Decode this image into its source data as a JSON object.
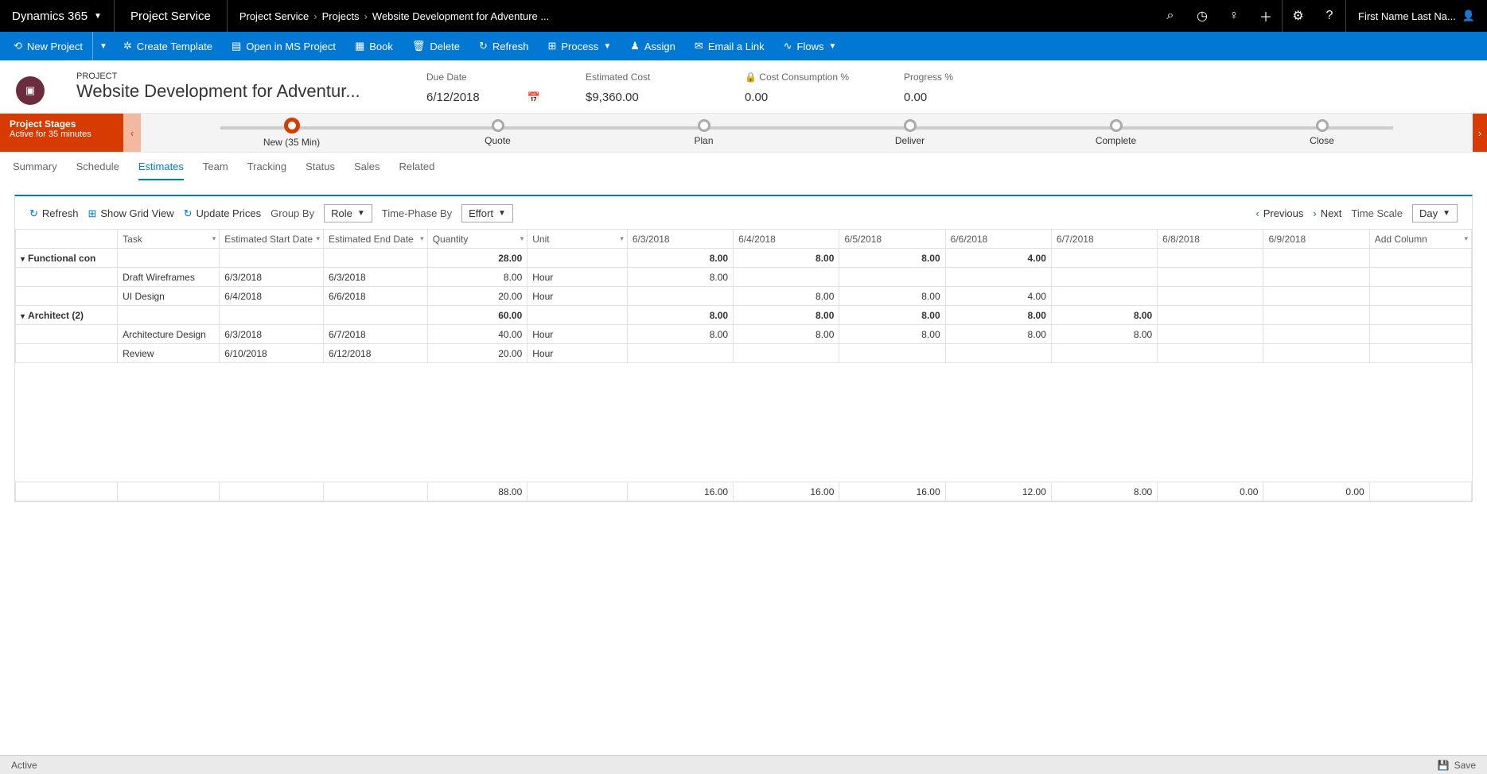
{
  "topbar": {
    "brand": "Dynamics 365",
    "app": "Project Service",
    "breadcrumb": [
      "Project Service",
      "Projects",
      "Website Development for Adventure ..."
    ],
    "user": "First Name Last Na..."
  },
  "cmdbar": {
    "new": "New Project",
    "create_template": "Create Template",
    "open_ms": "Open in MS Project",
    "book": "Book",
    "delete": "Delete",
    "refresh": "Refresh",
    "process": "Process",
    "assign": "Assign",
    "email": "Email a Link",
    "flows": "Flows"
  },
  "header": {
    "label": "PROJECT",
    "title": "Website Development for Adventur...",
    "due_date_label": "Due Date",
    "due_date": "6/12/2018",
    "est_cost_label": "Estimated Cost",
    "est_cost": "$9,360.00",
    "cost_con_label": "Cost Consumption %",
    "cost_con": "0.00",
    "progress_label": "Progress %",
    "progress": "0.00"
  },
  "stagebar": {
    "title": "Project Stages",
    "subtitle": "Active for 35 minutes",
    "stages": [
      "New  (35 Min)",
      "Quote",
      "Plan",
      "Deliver",
      "Complete",
      "Close"
    ]
  },
  "tabs": [
    "Summary",
    "Schedule",
    "Estimates",
    "Team",
    "Tracking",
    "Status",
    "Sales",
    "Related"
  ],
  "active_tab": "Estimates",
  "grid_toolbar": {
    "refresh": "Refresh",
    "grid_view": "Show Grid View",
    "update_prices": "Update Prices",
    "group_by": "Group By",
    "group_by_value": "Role",
    "time_phase": "Time-Phase By",
    "time_phase_value": "Effort",
    "previous": "Previous",
    "next": "Next",
    "time_scale": "Time Scale",
    "time_scale_value": "Day"
  },
  "columns": {
    "task": "Task",
    "start": "Estimated Start Date",
    "end": "Estimated End Date",
    "qty": "Quantity",
    "unit": "Unit",
    "dates": [
      "6/3/2018",
      "6/4/2018",
      "6/5/2018",
      "6/6/2018",
      "6/7/2018",
      "6/8/2018",
      "6/9/2018"
    ],
    "add": "Add Column"
  },
  "group1": {
    "name": "Functional con",
    "qty": "28.00",
    "d": [
      "8.00",
      "8.00",
      "8.00",
      "4.00",
      "",
      "",
      ""
    ]
  },
  "row1": {
    "task": "Draft Wireframes",
    "start": "6/3/2018",
    "end": "6/3/2018",
    "qty": "8.00",
    "unit": "Hour",
    "d": [
      "8.00",
      "",
      "",
      "",
      "",
      "",
      ""
    ]
  },
  "row2": {
    "task": "UI Design",
    "start": "6/4/2018",
    "end": "6/6/2018",
    "qty": "20.00",
    "unit": "Hour",
    "d": [
      "",
      "8.00",
      "8.00",
      "4.00",
      "",
      "",
      ""
    ]
  },
  "group2": {
    "name": "Architect (2)",
    "qty": "60.00",
    "d": [
      "8.00",
      "8.00",
      "8.00",
      "8.00",
      "8.00",
      "",
      ""
    ]
  },
  "row3": {
    "task": "Architecture Design",
    "start": "6/3/2018",
    "end": "6/7/2018",
    "qty": "40.00",
    "unit": "Hour",
    "d": [
      "8.00",
      "8.00",
      "8.00",
      "8.00",
      "8.00",
      "",
      ""
    ]
  },
  "row4": {
    "task": "Review",
    "start": "6/10/2018",
    "end": "6/12/2018",
    "qty": "20.00",
    "unit": "Hour",
    "d": [
      "",
      "",
      "",
      "",
      "",
      "",
      ""
    ]
  },
  "totals": {
    "qty": "88.00",
    "d": [
      "16.00",
      "16.00",
      "16.00",
      "12.00",
      "8.00",
      "0.00",
      "0.00"
    ]
  },
  "statusbar": {
    "status": "Active",
    "save": "Save"
  }
}
